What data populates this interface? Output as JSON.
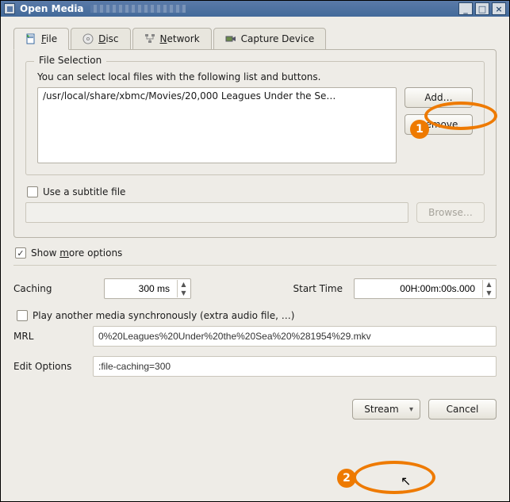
{
  "window": {
    "title": "Open Media"
  },
  "tabs": {
    "file": {
      "label": "File",
      "underline": "F"
    },
    "disc": {
      "label": "Disc",
      "underline": "D"
    },
    "network": {
      "label": "Network",
      "underline": "N"
    },
    "capture": {
      "label": "Capture Device"
    }
  },
  "file_selection": {
    "title": "File Selection",
    "hint": "You can select local files with the following list and buttons.",
    "items": [
      "/usr/local/share/xbmc/Movies/20,000 Leagues Under the Se…"
    ],
    "add_label": "Add…",
    "remove_label": "Remove"
  },
  "subtitle": {
    "label": "Use a subtitle file",
    "checked": false,
    "path": "",
    "browse_label": "Browse…"
  },
  "more_options": {
    "label": "Show more options",
    "underline": "m",
    "checked": true
  },
  "options": {
    "caching_label": "Caching",
    "caching_value": "300 ms",
    "start_time_label": "Start Time",
    "start_time_value": "00H:00m:00s.000",
    "play_sync_label": "Play another media synchronously (extra audio file, …)",
    "play_sync_checked": false,
    "mrl_label": "MRL",
    "mrl_value": "0%20Leagues%20Under%20the%20Sea%20%281954%29.mkv",
    "edit_options_label": "Edit Options",
    "edit_options_value": ":file-caching=300"
  },
  "footer": {
    "stream_label": "Stream",
    "cancel_label": "Cancel"
  },
  "annotations": {
    "badge1": "1",
    "badge2": "2"
  }
}
